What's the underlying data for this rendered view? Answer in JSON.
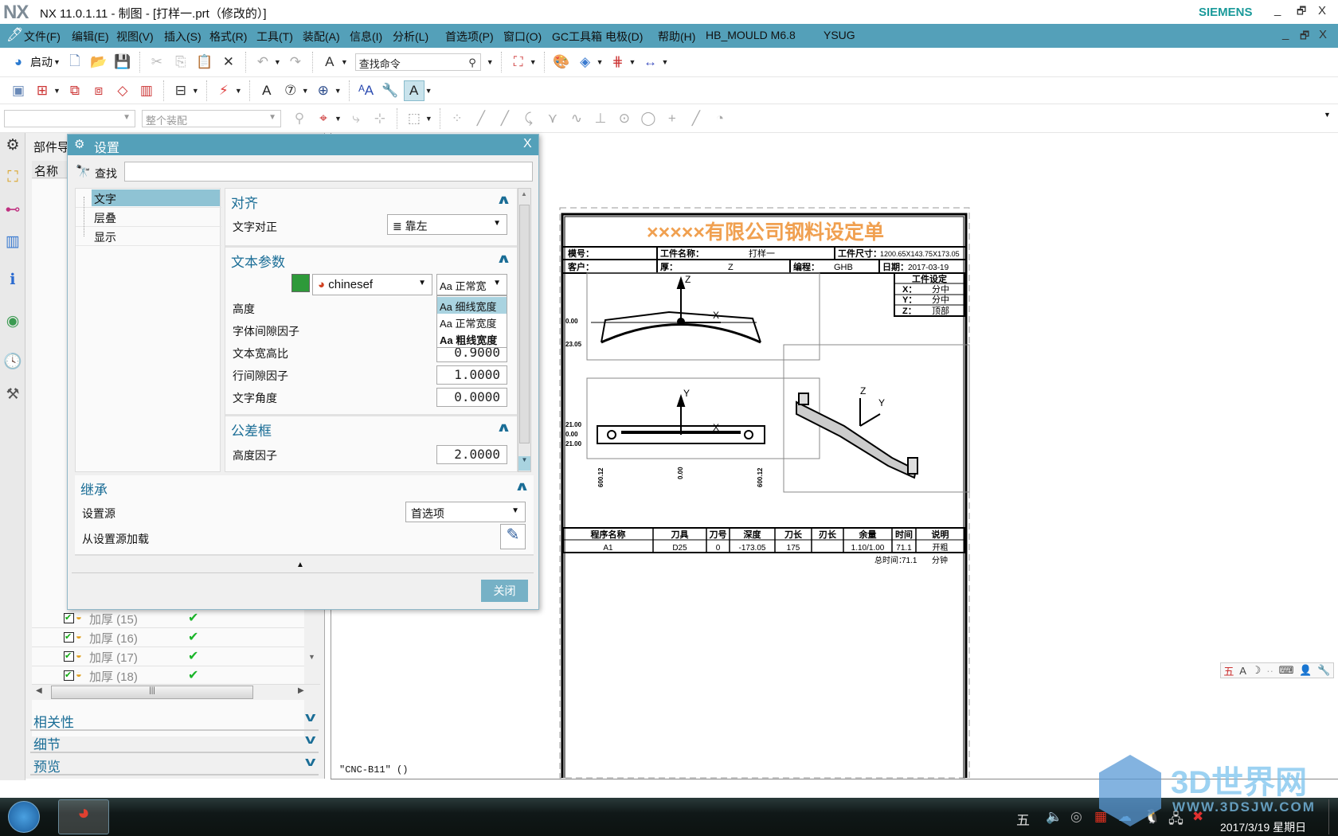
{
  "titlebar": {
    "logo": "NX",
    "title": "NX 11.0.1.11 - 制图 - [打样一.prt（修改的）]",
    "brand": "SIEMENS",
    "minimize": "_",
    "restore": "🗗",
    "close": "X"
  },
  "menubar": {
    "items": [
      "文件(F)",
      "编辑(E)",
      "视图(V)",
      "插入(S)",
      "格式(R)",
      "工具(T)",
      "装配(A)",
      "信息(I)",
      "分析(L)",
      "首选项(P)",
      "窗口(O)",
      "GC工具箱",
      "电极(D)",
      "帮助(H)",
      "HB_MOULD M6.8",
      "YSUG"
    ],
    "minimize": "_",
    "restore": "🗗",
    "close": "X"
  },
  "toolbar": {
    "start_label": "启动",
    "search_placeholder": "查找命令",
    "assembly_combo": "整个装配",
    "row1": [
      {
        "icon": "new-file-icon",
        "glyph": "🗋",
        "color": "#6a8ab8"
      },
      {
        "icon": "open-folder-icon",
        "glyph": "📂",
        "color": "#c9a040"
      },
      {
        "icon": "save-icon",
        "glyph": "💾",
        "color": "#4a6a9a"
      },
      {
        "sep": true
      },
      {
        "icon": "cut-icon",
        "glyph": "✂",
        "color": "#bbb"
      },
      {
        "icon": "copy-icon",
        "glyph": "⎘",
        "color": "#bbb"
      },
      {
        "icon": "paste-icon",
        "glyph": "📋",
        "color": "#bbb"
      },
      {
        "icon": "delete-icon",
        "glyph": "✕",
        "color": "#333"
      },
      {
        "sep": true
      },
      {
        "icon": "undo-icon",
        "glyph": "↶",
        "color": "#aaa",
        "dd": true
      },
      {
        "icon": "redo-icon",
        "glyph": "↷",
        "color": "#aaa"
      },
      {
        "sep": true
      },
      {
        "icon": "annotation-edit-icon",
        "glyph": "A",
        "color": "#333",
        "dd": true
      }
    ],
    "row1b": [
      {
        "icon": "fit-view-icon",
        "glyph": "⛶",
        "color": "#d04040",
        "dd": true
      },
      {
        "sep": true
      },
      {
        "icon": "palette-icon",
        "glyph": "🎨",
        "color": "#c90"
      },
      {
        "icon": "view-direction-icon",
        "glyph": "◈",
        "color": "#3a7ad0",
        "dd": true
      },
      {
        "icon": "grid-snap-icon",
        "glyph": "⋕",
        "color": "#c33",
        "dd": true
      },
      {
        "icon": "measure-icon",
        "glyph": "↔",
        "color": "#4050c0",
        "dd": true
      }
    ],
    "row2": [
      {
        "icon": "new-sheet-icon",
        "glyph": "▣",
        "color": "#6a8ab8"
      },
      {
        "icon": "view-creation-icon",
        "glyph": "⊞",
        "color": "#c33",
        "dd": true
      },
      {
        "icon": "projected-view-icon",
        "glyph": "⧉",
        "color": "#c33"
      },
      {
        "icon": "section-view-icon",
        "glyph": "⧈",
        "color": "#c33"
      },
      {
        "icon": "break-view-icon",
        "glyph": "◇",
        "color": "#c33"
      },
      {
        "icon": "hatch-icon",
        "glyph": "▥",
        "color": "#c33"
      },
      {
        "sep": true
      },
      {
        "icon": "table-icon",
        "glyph": "⊟",
        "color": "#333",
        "dd": true
      },
      {
        "sep": true
      },
      {
        "icon": "dimension-icon",
        "glyph": "⚡",
        "color": "#e04040",
        "dd": true
      },
      {
        "sep": true
      },
      {
        "icon": "note-icon",
        "glyph": "A",
        "color": "#222"
      },
      {
        "icon": "balloon-icon",
        "glyph": "⑦",
        "color": "#333",
        "dd": true
      },
      {
        "icon": "center-mark-icon",
        "glyph": "⊕",
        "color": "#2a4a8a",
        "dd": true
      },
      {
        "sep": true
      },
      {
        "icon": "text-style-icon",
        "glyph": "ᴬA",
        "color": "#2a4ab0"
      },
      {
        "icon": "style-inherit-icon",
        "glyph": "🔧",
        "color": "#c90"
      },
      {
        "icon": "settings-active-icon",
        "glyph": "A",
        "color": "#222",
        "dd": true,
        "active": true
      }
    ],
    "row3": [
      {
        "icon": "select-filter-icon",
        "glyph": "⚲",
        "color": "#bbb"
      },
      {
        "icon": "snap-point-icon",
        "glyph": "⌖",
        "color": "#c33",
        "dd": true
      },
      {
        "icon": "snap-end-icon",
        "glyph": "⤷",
        "color": "#bbb"
      },
      {
        "icon": "snap-mid-icon",
        "glyph": "⊹",
        "color": "#bbb"
      },
      {
        "sep": true
      },
      {
        "icon": "box-select-icon",
        "glyph": "⬚",
        "color": "#999",
        "dd": true
      },
      {
        "sep": true
      },
      {
        "icon": "snap-existing-icon",
        "glyph": "⁘",
        "color": "#bbb"
      },
      {
        "icon": "line-end-icon",
        "glyph": "╱",
        "color": "#aaa"
      },
      {
        "icon": "line-mid-icon",
        "glyph": "╱",
        "color": "#aaa"
      },
      {
        "icon": "curve-control-icon",
        "glyph": "⤹",
        "color": "#aaa"
      },
      {
        "icon": "intersection-icon",
        "glyph": "⋎",
        "color": "#aaa"
      },
      {
        "icon": "spline-icon",
        "glyph": "∿",
        "color": "#aaa"
      },
      {
        "icon": "perpendicular-icon",
        "glyph": "⊥",
        "color": "#aaa"
      },
      {
        "icon": "arc-center-icon",
        "glyph": "⊙",
        "color": "#aaa"
      },
      {
        "icon": "quadrant-icon",
        "glyph": "◯",
        "color": "#aaa"
      },
      {
        "icon": "point-icon",
        "glyph": "+",
        "color": "#aaa"
      },
      {
        "icon": "on-curve-icon",
        "glyph": "╱",
        "color": "#aaa"
      },
      {
        "icon": "on-face-icon",
        "glyph": "◔",
        "color": "#aaa"
      }
    ]
  },
  "leftstrip": [
    {
      "icon": "gear-icon",
      "glyph": "⚙",
      "color": "#333"
    },
    {
      "icon": "assembly-navigator-icon",
      "glyph": "⛶",
      "color": "#d9a020"
    },
    {
      "icon": "part-navigator-icon",
      "glyph": "⊷",
      "color": "#c03080"
    },
    {
      "icon": "reuse-library-icon",
      "glyph": "▥",
      "color": "#3a7ad0"
    },
    {
      "icon": "info-icon",
      "glyph": "ℹ",
      "color": "#2a6ad0"
    },
    {
      "icon": "web-browser-icon",
      "glyph": "◉",
      "color": "#3a9a50"
    },
    {
      "icon": "history-clock-icon",
      "glyph": "🕓",
      "color": "#335"
    },
    {
      "icon": "roles-icon",
      "glyph": "⚒",
      "color": "#555"
    }
  ],
  "navigator": {
    "title": "部件导",
    "column_name": "名称",
    "rows": [
      {
        "label": "加厚 (15)",
        "check": "✔"
      },
      {
        "label": "加厚 (16)",
        "check": "✔"
      },
      {
        "label": "加厚 (17)",
        "check": "✔"
      },
      {
        "label": "加厚 (18)",
        "check": "✔"
      }
    ],
    "sections": [
      "相关性",
      "细节",
      "预览"
    ]
  },
  "dialog": {
    "title": "设置",
    "close": "X",
    "search_label": "查找",
    "search_value": "",
    "tree": [
      "文字",
      "层叠",
      "显示"
    ],
    "selected": 0,
    "align": {
      "header": "对齐",
      "justify_label": "文字对正",
      "justify_value": "靠左"
    },
    "params": {
      "header": "文本参数",
      "color": "#2e9a3a",
      "font": "chinesef",
      "width_value": "正常宽",
      "width_options": [
        "细线宽度",
        "正常宽度",
        "粗线宽度"
      ],
      "highlighted_option": 0,
      "height_label": "高度",
      "gap_label": "字体间隙因子",
      "aspect_label": "文本宽高比",
      "aspect_value": "0.9000",
      "line_gap_label": "行间隙因子",
      "line_gap_value": "1.0000",
      "angle_label": "文字角度",
      "angle_value": "0.0000"
    },
    "tolerance": {
      "header": "公差框",
      "height_factor_label": "高度因子",
      "height_factor_value": "2.0000"
    },
    "inherit": {
      "header": "继承",
      "source_label": "设置源",
      "source_value": "首选项",
      "load_label": "从设置源加载"
    },
    "close_button": "关闭"
  },
  "drawing": {
    "title": "×××××有限公司钢料设定单",
    "title_color": "#f0a050",
    "mold_no_label": "模号：",
    "part_name_label": "工件名称：",
    "part_name": "打样一",
    "part_size_label": "工件尺寸：",
    "part_size": "1200.65X143.75X173.05",
    "customer_label": "客户：",
    "thickness_label": "厚：",
    "thickness": "Z",
    "programmer_label": "编程：",
    "programmer": "GHB",
    "date_label": "日期：",
    "date": "2017-03-19",
    "setup": {
      "header": "工件设定",
      "rows": [
        [
          "X：",
          "分中"
        ],
        [
          "Y：",
          "分中"
        ],
        [
          "Z：",
          "顶部"
        ]
      ]
    },
    "table": {
      "headers": [
        "程序名称",
        "刀具",
        "刀号",
        "深度",
        "刀长",
        "刃长",
        "余量",
        "时间",
        "说明"
      ],
      "row": [
        "A1",
        "D25",
        "0",
        "-173.05",
        "175",
        "",
        "1.10/1.00",
        "71.1",
        "开粗"
      ]
    },
    "total_label": "总时间：",
    "total_value": "71.1",
    "total_unit": "分钟",
    "axis_labels": {
      "z": "Z",
      "x": "X",
      "y": "Y"
    },
    "view_dims": [
      "0.00",
      "23.05",
      "21.00",
      "0.00",
      "21.00",
      "600.12",
      "0.00",
      "600.12"
    ]
  },
  "status": {
    "text": "\"CNC-B11\"  ()"
  },
  "ime_toolbar": [
    {
      "icon": "ime-five-icon",
      "glyph": "五",
      "color": "#c33"
    },
    {
      "icon": "ime-font-icon",
      "glyph": "A",
      "color": "#444"
    },
    {
      "icon": "ime-moon-icon",
      "glyph": "☽",
      "color": "#333"
    },
    {
      "icon": "ime-dots-icon",
      "glyph": "··",
      "color": "#aaa"
    },
    {
      "icon": "ime-keyboard-icon",
      "glyph": "⌨",
      "color": "#444"
    },
    {
      "icon": "ime-user-icon",
      "glyph": "👤",
      "color": "#444"
    },
    {
      "icon": "ime-wrench-icon",
      "glyph": "🔧",
      "color": "#444"
    }
  ],
  "taskbar": {
    "clock_date": "2017/3/19 星期日",
    "tray": [
      {
        "icon": "ime-tray-icon",
        "glyph": "五",
        "color": "#ddd"
      },
      {
        "icon": "volume-icon",
        "glyph": "🔈",
        "color": "#e07040"
      },
      {
        "icon": "webcam-icon",
        "glyph": "◎",
        "color": "#aaa"
      },
      {
        "icon": "ccl-app-icon",
        "glyph": "▦",
        "color": "#e03020"
      },
      {
        "icon": "cloud-app-icon",
        "glyph": "☁",
        "color": "#6ab0e0"
      },
      {
        "icon": "qq-icon",
        "glyph": "🐧",
        "color": "#fff"
      },
      {
        "icon": "network-icon",
        "glyph": "🖧",
        "color": "#ddd"
      },
      {
        "icon": "mute-error-icon",
        "glyph": "✖",
        "color": "#e03030"
      }
    ]
  },
  "watermark": {
    "text": "3D世界网",
    "url": "WWW.3DSJW.COM"
  }
}
